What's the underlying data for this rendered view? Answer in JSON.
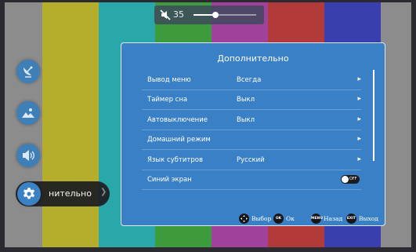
{
  "volume": {
    "icon": "mute-speaker-icon",
    "value": "35",
    "level": 0.35
  },
  "side_menu": {
    "items": [
      {
        "icon": "satellite-dish-icon"
      },
      {
        "icon": "picture-icon"
      },
      {
        "icon": "speaker-icon"
      }
    ],
    "active": {
      "icon": "gear-icon",
      "label": "нительно"
    }
  },
  "panel": {
    "title": "Дополнительно",
    "rows": [
      {
        "label": "Вывод меню",
        "value": "Всегда",
        "control": "arrow"
      },
      {
        "label": "Таймер сна",
        "value": "Выкл",
        "control": "arrow"
      },
      {
        "label": "Автовыключение",
        "value": "Выкл",
        "control": "arrow"
      },
      {
        "label": "Домашний режим",
        "value": "",
        "control": "arrow"
      },
      {
        "label": "Язык субтитров",
        "value": "Русский",
        "control": "arrow"
      },
      {
        "label": "Синий экран",
        "value": "",
        "control": "toggle",
        "toggle_text": "OFF"
      }
    ]
  },
  "footer": {
    "select": {
      "icon": "dpad-icon",
      "label": "Выбор"
    },
    "ok": {
      "button": "OK",
      "label": "Ок"
    },
    "back": {
      "button": "MENU",
      "label": "Назад"
    },
    "exit": {
      "button": "EXIT",
      "label": "Выход"
    }
  },
  "colors": {
    "test_bars": [
      "#8c8c8c",
      "#b5ad2c",
      "#2aa8a9",
      "#3d9b3e",
      "#a0429c",
      "#b33a3a",
      "#3a3fb0",
      "#8c8c8c"
    ],
    "panel_bg": "#3a80c6",
    "side_icon_bg": "#3f7fb8"
  }
}
